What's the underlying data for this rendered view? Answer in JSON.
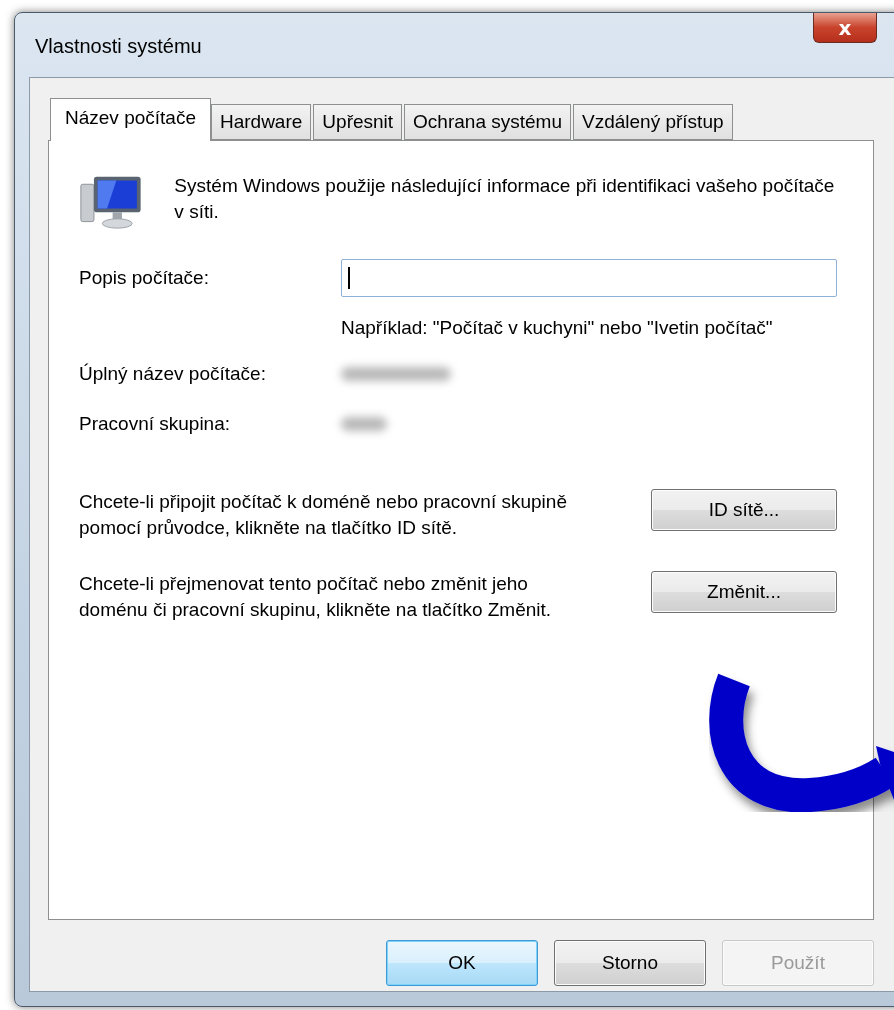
{
  "window": {
    "title": "Vlastnosti systému",
    "close_label": "x"
  },
  "tabs": [
    {
      "label": "Název počítače",
      "selected": true
    },
    {
      "label": "Hardware",
      "selected": false
    },
    {
      "label": "Upřesnit",
      "selected": false
    },
    {
      "label": "Ochrana systému",
      "selected": false
    },
    {
      "label": "Vzdálený přístup",
      "selected": false
    }
  ],
  "intro": "Systém Windows použije následující informace při identifikaci vašeho počítače v síti.",
  "description_field": {
    "label": "Popis počítače:",
    "hint": "Například: \"Počítač v kuchyni\" nebo \"Ivetin počítač\""
  },
  "info_rows": [
    {
      "label": "Úplný název počítače:",
      "value_redacted": true
    },
    {
      "label": "Pracovní skupina:",
      "value_redacted": true
    }
  ],
  "actions": [
    {
      "text": "Chcete-li připojit počítač k doméně nebo pracovní skupině pomocí průvodce, klikněte na tlačítko ID sítě.",
      "button": "ID sítě..."
    },
    {
      "text": "Chcete-li přejmenovat tento počítač nebo změnit jeho doménu či pracovní skupinu, klikněte na tlačítko Změnit.",
      "button": "Změnit..."
    }
  ],
  "buttons": [
    {
      "label": "OK",
      "kind": "default",
      "disabled": false
    },
    {
      "label": "Storno",
      "kind": "normal",
      "disabled": false
    },
    {
      "label": "Použít",
      "kind": "normal",
      "disabled": true
    }
  ]
}
